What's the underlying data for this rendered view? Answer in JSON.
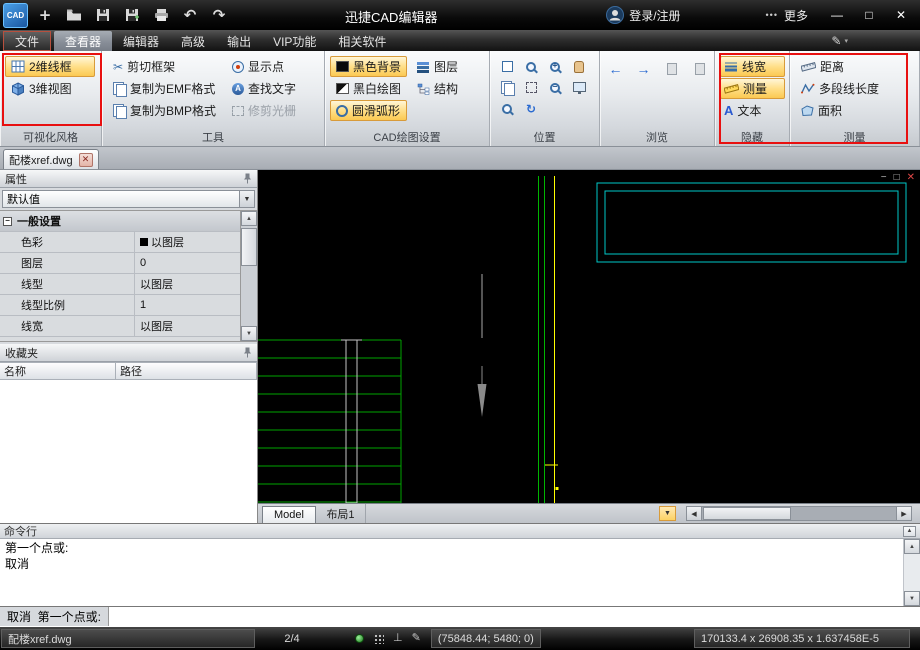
{
  "icons": {
    "logo": "CAD",
    "plus": "+",
    "undo": "↶",
    "redo": "↷",
    "ellipsis": "•••",
    "minimize": "—",
    "maximize": "□",
    "close": "✕",
    "menu_pen": "✎",
    "caret_down": "▼",
    "small_caret": "▾",
    "scissors": "✂",
    "find_a": "A",
    "text_a": "A",
    "back": "←",
    "forward": "→",
    "refresh": "↻",
    "up_arrow": "▲",
    "down_arrow": "▼",
    "scroll_left": "◀",
    "scroll_right": "▶",
    "collapse_up": "▲",
    "section_minus": "−",
    "ortho": "⊥",
    "pen": "✎",
    "mini_minimize": "−",
    "mini_restore": "□",
    "mini_close": "✕",
    "tab_close": "✕"
  },
  "titlebar": {
    "title": "迅捷CAD编辑器",
    "login_label": "登录/注册",
    "more_label": "更多"
  },
  "menubar": {
    "items": [
      {
        "label": "文件"
      },
      {
        "label": "查看器"
      },
      {
        "label": "编辑器"
      },
      {
        "label": "高级"
      },
      {
        "label": "输出"
      },
      {
        "label": "VIP功能"
      },
      {
        "label": "相关软件"
      }
    ]
  },
  "ribbon": {
    "visual": {
      "label": "可视化风格",
      "btn2d": "2维线框",
      "btn3d": "3维视图"
    },
    "tools": {
      "label": "工具",
      "clip_frame": "剪切框架",
      "copy_emf": "复制为EMF格式",
      "copy_bmp": "复制为BMP格式",
      "show_points": "显示点",
      "find_text": "查找文字",
      "trim_raster": "修剪光栅"
    },
    "draw": {
      "label": "CAD绘图设置",
      "black_bg": "黑色背景",
      "bw": "黑白绘图",
      "arc": "圆滑弧形",
      "layers": "图层",
      "structure": "结构"
    },
    "position": {
      "label": "位置"
    },
    "browse": {
      "label": "浏览"
    },
    "hide": {
      "label": "隐藏",
      "lineweight": "线宽",
      "measure": "测量",
      "text": "文本"
    },
    "measure": {
      "label": "测量",
      "distance": "距离",
      "polyline": "多段线长度",
      "area": "面积"
    }
  },
  "doc_tab": {
    "label": "配楼xref.dwg"
  },
  "properties": {
    "title": "属性",
    "preset": "默认值",
    "section": "一般设置",
    "rows": [
      {
        "name": "色彩",
        "value": "以图层"
      },
      {
        "name": "图层",
        "value": "0"
      },
      {
        "name": "线型",
        "value": "以图层"
      },
      {
        "name": "线型比例",
        "value": "1"
      },
      {
        "name": "线宽",
        "value": "以图层"
      }
    ]
  },
  "favorites": {
    "title": "收藏夹",
    "col_name": "名称",
    "col_path": "路径"
  },
  "drawing": {
    "model_tab": "Model",
    "layout_tab": "布局1"
  },
  "command": {
    "title": "命令行",
    "history": [
      "第一个点或:",
      "取消"
    ],
    "prompt": "取消  第一个点或:"
  },
  "statusbar": {
    "file": "配楼xref.dwg",
    "page": "2/4",
    "coords": "(75848.44; 5480; 0)",
    "dims": "170133.4 x 26908.35 x 1.637458E-5"
  }
}
